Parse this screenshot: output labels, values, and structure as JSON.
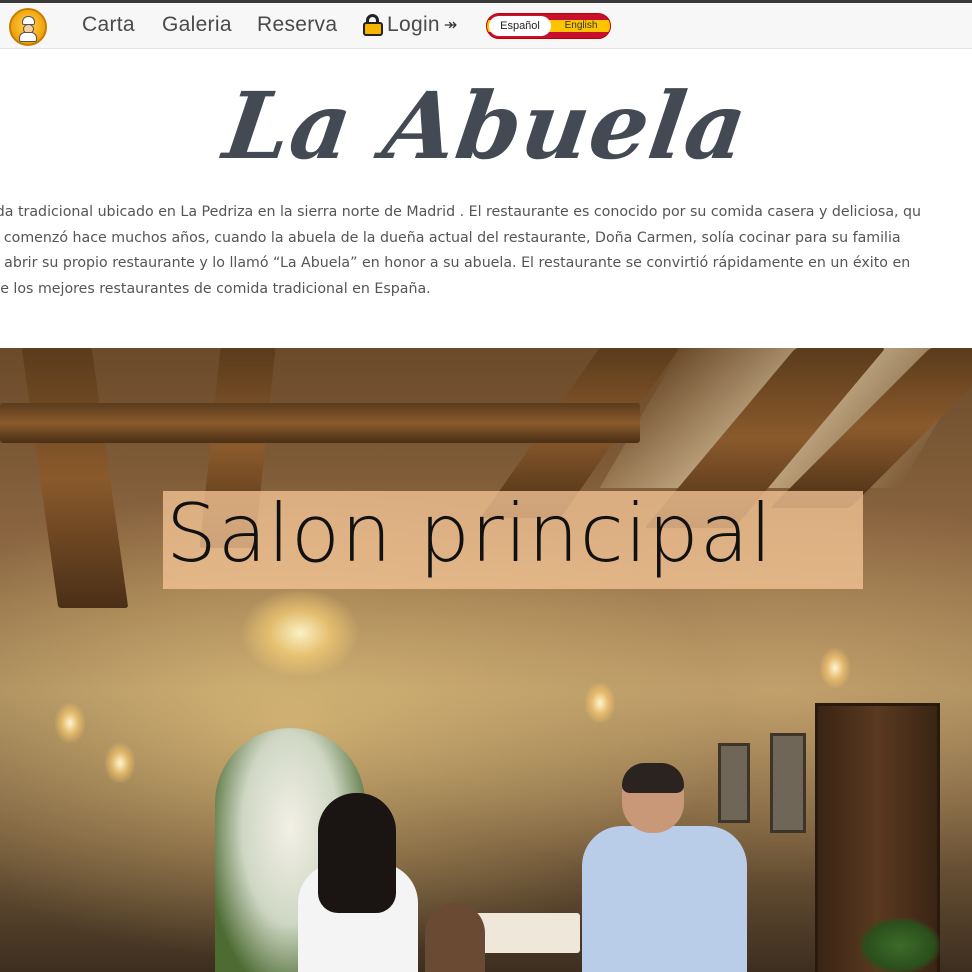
{
  "nav": {
    "logo_icon": "chef-grandmother-logo-icon",
    "links": [
      "Carta",
      "Galeria",
      "Reserva"
    ],
    "login_label": "Login",
    "login_icon": "lock-icon",
    "login_arrow_icon": "arrow-right-icon",
    "language": {
      "option_es": "Español",
      "option_en": "English",
      "selected": "Español",
      "colors": {
        "red": "#c8102e",
        "yellow": "#ffc400"
      }
    }
  },
  "header": {
    "title": "La Abuela"
  },
  "description": {
    "lines": [
      "mida tradicional ubicado en La Pedriza en la sierra norte de Madrid . El restaurante es conocido por su comida casera y deliciosa, qu",
      "ela comenzó hace muchos años, cuando la abuela de la dueña actual del restaurante, Doña Carmen, solía cocinar para su familia",
      "dió abrir su propio restaurante y lo llamó “La Abuela” en honor a su abuela. El restaurante se convirtió rápidamente en un éxito en",
      "o de los mejores restaurantes de comida tradicional en España."
    ]
  },
  "hero": {
    "caption": "Salon principal",
    "image_subject": "restaurant-main-hall-photo"
  }
}
